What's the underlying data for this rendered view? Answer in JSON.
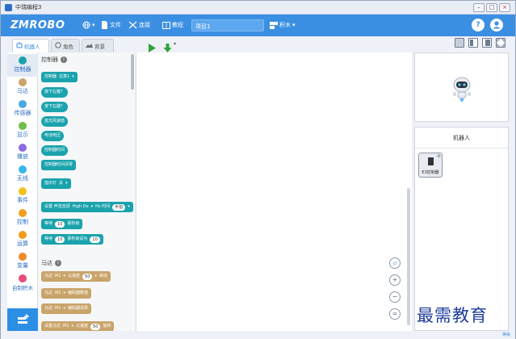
{
  "window": {
    "title": "中瑞编程3",
    "minimize": "–",
    "maximize": "□",
    "close": "×"
  },
  "toolbar": {
    "logo": "ZMROBO",
    "globe_arrow": "▾",
    "file_label": "文件",
    "connect_label": "连接",
    "tutorial_label": "教程",
    "project_name": "项目1",
    "mode_label": "积木",
    "mode_arrow": "▾",
    "help_label": "?",
    "user_label": "",
    "icons": {
      "globe": "globe-icon",
      "file": "file-icon",
      "connect": "unplug-icon",
      "tutorial": "tutorial-icon",
      "mode": "blocks-icon",
      "help": "help-icon",
      "user": "user-icon"
    }
  },
  "tabs": [
    {
      "label": "机器人",
      "active": true
    },
    {
      "label": "角色",
      "active": false
    },
    {
      "label": "背景",
      "active": false
    }
  ],
  "categories": [
    {
      "label": "控制器",
      "color": "#1aa3ad"
    },
    {
      "label": "马达",
      "color": "#c9a46a"
    },
    {
      "label": "传感器",
      "color": "#4aa8e0"
    },
    {
      "label": "显示",
      "color": "#6fbe4a"
    },
    {
      "label": "播放",
      "color": "#8c6ce0"
    },
    {
      "label": "无线",
      "color": "#38b6e8"
    },
    {
      "label": "事件",
      "color": "#f2c318"
    },
    {
      "label": "控制",
      "color": "#f0a020"
    },
    {
      "label": "运算",
      "color": "#f39a1a"
    },
    {
      "label": "变量",
      "color": "#f08a2a"
    },
    {
      "label": "自制积木",
      "color": "#e84a78"
    }
  ],
  "palette": {
    "section1": "控制器",
    "blocks1": [
      {
        "label": "控制器",
        "dropdown": "任意1",
        "arrow": "▾"
      },
      {
        "label": "按下左键？"
      },
      {
        "label": "按下右键？"
      },
      {
        "label": "蓝光风速值"
      },
      {
        "label": "电池电压"
      },
      {
        "label": "控制器时间"
      },
      {
        "label": "控制器时间清零"
      },
      {
        "label": "指示灯",
        "dropdown": "关",
        "arrow": "▾"
      },
      {
        "label": "设置 声音音调",
        "dropdown": "High Do",
        "arrow": "▾",
        "extra": "Hz 时间",
        "dropdown2": "半拍",
        "arrow2": "▾"
      },
      {
        "label": "等待",
        "value": "10",
        "suffix": "豪秒级"
      },
      {
        "label": "等待",
        "value": "10",
        "suffix": "豪秒级设为",
        "value2": "10"
      }
    ],
    "section2": "马达",
    "blocks2": [
      {
        "label": "马达",
        "dropdown": "M1",
        "arrow": "▾",
        "extra": "以速度",
        "value": "50",
        "dd_arrow": "▾",
        "suffix": "转动"
      },
      {
        "label": "马达",
        "dropdown": "M1",
        "arrow": "▾",
        "extra": "编码器数值"
      },
      {
        "label": "马达",
        "dropdown": "M1",
        "arrow": "▾",
        "extra": "编码器清零"
      },
      {
        "label": "设置马达",
        "dropdown": "M1",
        "arrow": "▾",
        "extra": "以速度",
        "value": "50",
        "suffix": "旋转"
      }
    ]
  },
  "sprites": {
    "header": "机器人",
    "card_name": "E3控制器"
  },
  "zoom_controls": {
    "code": "⟨/⟩",
    "zoom_in": "+",
    "zoom_out": "−",
    "reset": "="
  },
  "watermark": "最需教育",
  "status": "等级"
}
